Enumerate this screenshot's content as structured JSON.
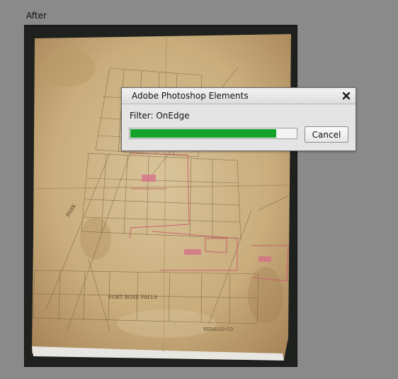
{
  "preview": {
    "label": "After"
  },
  "dialog": {
    "title": "Adobe Photoshop Elements",
    "status": "Filter: OnEdge",
    "progress": 0.88,
    "cancel_label": "Cancel",
    "close_icon": "close-icon",
    "progress_color": "#13a32b"
  },
  "colors": {
    "background": "#8a8a8a",
    "frame": "#1e211d",
    "paper": "#c9ad7c"
  },
  "map_text": {
    "district_label": "FORT ROSE FALLS",
    "county_label": "HIDALGO CO.",
    "side_label": "PARK"
  }
}
